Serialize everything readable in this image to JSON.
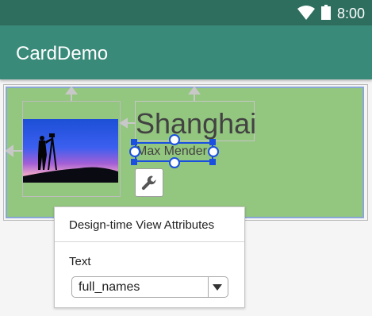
{
  "status_bar": {
    "time": "8:00",
    "icons": [
      "wifi-icon",
      "battery-icon"
    ]
  },
  "app_bar": {
    "title": "CardDemo"
  },
  "card": {
    "background_color": "#93c67f",
    "city": "Shanghai",
    "name": "Max Mender",
    "photo": "silhouette-photographer-at-sunset"
  },
  "popup": {
    "title": "Design-time View Attributes",
    "field_label": "Text",
    "select_value": "full_names"
  },
  "colors": {
    "status_bar": "#2e6e5f",
    "app_bar": "#3a8a7a",
    "selection": "#1a4fe0"
  }
}
